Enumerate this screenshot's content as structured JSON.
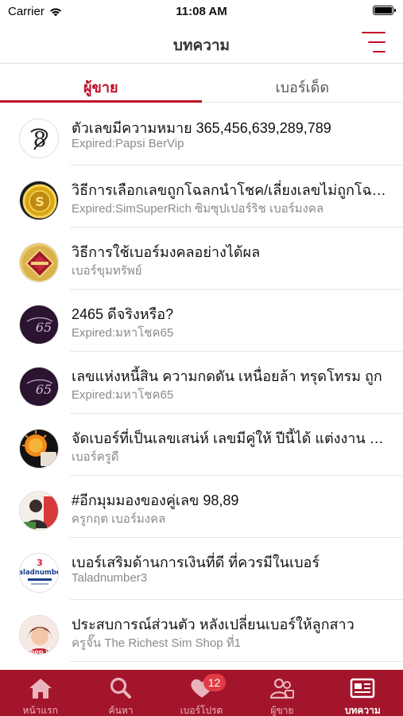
{
  "status_bar": {
    "carrier": "Carrier",
    "time": "11:08 AM"
  },
  "nav": {
    "title": "บทความ"
  },
  "tabs": [
    {
      "label": "ผู้ขาย",
      "active": true
    },
    {
      "label": "เบอร์เด็ด",
      "active": false
    }
  ],
  "articles": [
    {
      "title": "ตัวเลขมีความหมาย 365,456,639,289,789",
      "subtitle": "Expired:Papsi BerVip",
      "avatar": "papsi-logo"
    },
    {
      "title": "วิธีการเลือกเลขถูกโฉลกนำโชค/เลี่ยงเลขไม่ถูกโฉลก",
      "subtitle": "Expired:SimSuperRich ซิมซุปเปอร์ริช เบอร์มงคล",
      "avatar": "gold-coin-logo"
    },
    {
      "title": "วิธีการใช้เบอร์มงคลอย่างได้ผล",
      "subtitle": "เบอร์ขุมทรัพย์",
      "avatar": "treasure-logo"
    },
    {
      "title": "2465 ดีจริงหรือ?",
      "subtitle": "Expired:มหาโชค65",
      "avatar": "mahachok-logo"
    },
    {
      "title": "เลขแห่งหนี้สิน ความกดดัน เหนื่อยล้า ทรุดโทรม ถูก",
      "subtitle": "Expired:มหาโชค65",
      "avatar": "mahachok-logo"
    },
    {
      "title": "จัดเบอร์ที่เป็นเลขเสน่ห์ เลขมีคู่ให้ ปีนี้ได้ แต่งงาน แล้ว",
      "subtitle": "เบอร์ครูดี",
      "avatar": "kruudee-logo"
    },
    {
      "title": "#อีกมุมมองของคู่เลข 98,89",
      "subtitle": "ครูกฤต เบอร์มงคล",
      "avatar": "krukrit-photo"
    },
    {
      "title": "เบอร์เสริมด้านการเงินที่ดี ที่ควรมีในเบอร์",
      "subtitle": "Taladnumber3",
      "avatar": "taladnumber-logo"
    },
    {
      "title": "ประสบการณ์ส่วนตัว หลังเปลี่ยนเบอร์ให้ลูกสาว",
      "subtitle": "ครูจั๊น The Richest Sim Shop ที่1",
      "avatar": "richest-sim-photo"
    }
  ],
  "avatar_texts": {
    "taladnumber": "taladnumber",
    "num3": "3",
    "shop1": "Shop ที่1",
    "mahachok": "65"
  },
  "tab_bar": [
    {
      "label": "หน้าแรก",
      "icon": "home-icon",
      "active": false
    },
    {
      "label": "ค้นหา",
      "icon": "search-icon",
      "active": false
    },
    {
      "label": "เบอร์โปรด",
      "icon": "heart-icon",
      "active": false,
      "badge": "12"
    },
    {
      "label": "ผู้ขาย",
      "icon": "sellers-icon",
      "active": false
    },
    {
      "label": "บทความ",
      "icon": "article-icon",
      "active": true
    }
  ],
  "colors": {
    "accent": "#c0102a",
    "tab_bar": "#a3152b",
    "badge": "#e23b45"
  }
}
